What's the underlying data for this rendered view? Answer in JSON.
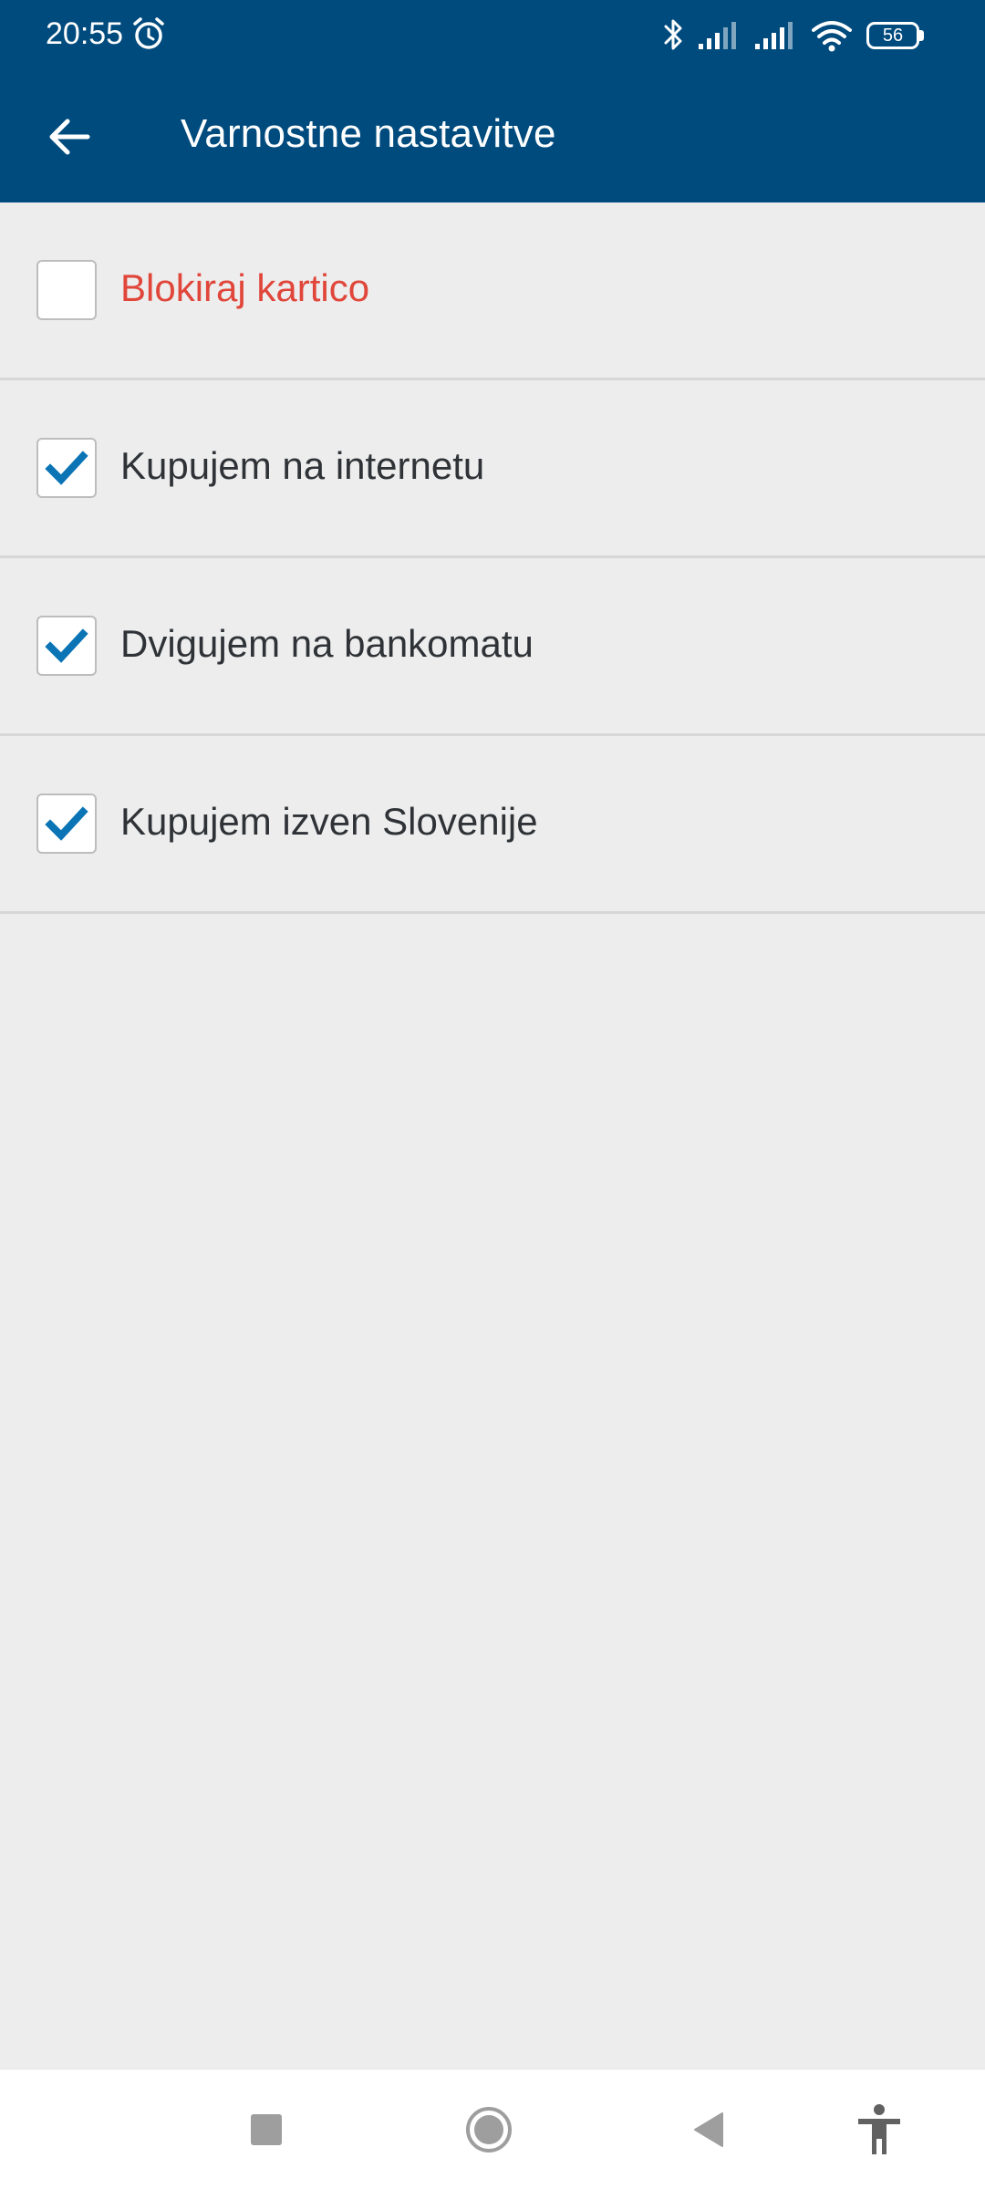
{
  "status_bar": {
    "time": "20:55",
    "battery": "56",
    "icons": [
      "alarm-icon",
      "bluetooth-icon",
      "signal-icon",
      "signal-icon",
      "wifi-icon",
      "battery-icon"
    ]
  },
  "app_bar": {
    "title": "Varnostne nastavitve",
    "back_icon": "arrow-left-icon"
  },
  "settings": {
    "items": [
      {
        "label": "Blokiraj kartico",
        "checked": false,
        "style": "danger"
      },
      {
        "label": "Kupujem na internetu",
        "checked": true,
        "style": "normal"
      },
      {
        "label": "Dvigujem na bankomatu",
        "checked": true,
        "style": "normal"
      },
      {
        "label": "Kupujem izven Slovenije",
        "checked": true,
        "style": "normal"
      }
    ]
  },
  "nav_bar": {
    "icons": [
      "recents-icon",
      "home-icon",
      "back-icon",
      "accessibility-icon"
    ]
  },
  "colors": {
    "header": "#004b7e",
    "background": "#ededed",
    "check": "#0a74b5",
    "danger": "#e0463a",
    "text": "#2f3337"
  }
}
